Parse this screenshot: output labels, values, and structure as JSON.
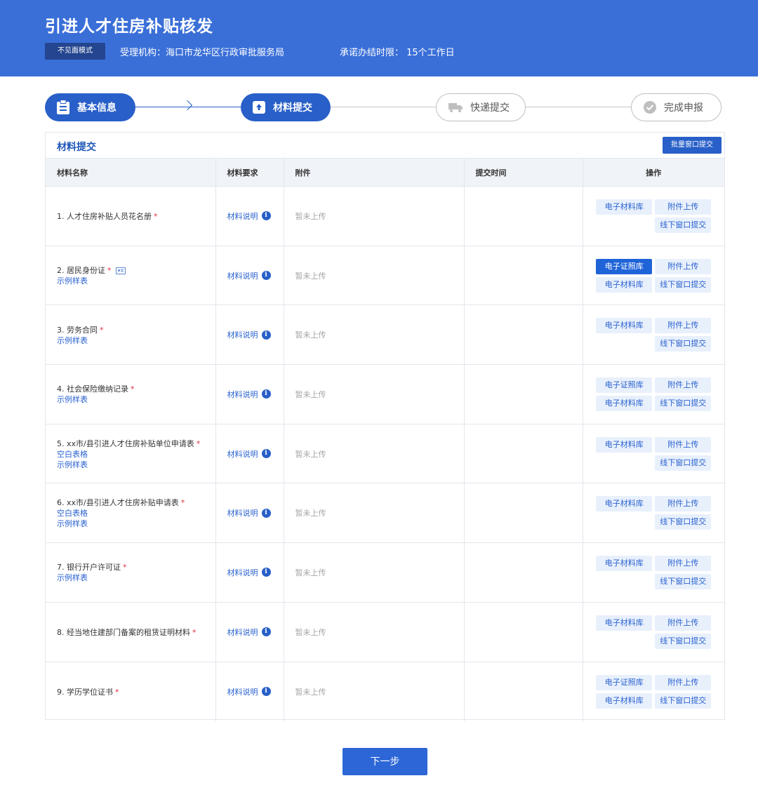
{
  "header": {
    "title": "引进人才住房补贴核发",
    "mode_badge": "不见面模式",
    "org": "受理机构：海口市龙华区行政审批服务局",
    "time_limit": "承诺办结时限： 15个工作日",
    "bg_color": "#3a6fd8"
  },
  "steps": [
    {
      "label": "基本信息",
      "state": "done",
      "icon": "clipboard-icon"
    },
    {
      "label": "材料提交",
      "state": "current",
      "icon": "upload-icon"
    },
    {
      "label": "快递提交",
      "state": "pending",
      "icon": "truck-icon"
    },
    {
      "label": "完成申报",
      "state": "pending",
      "icon": "check-circle-icon"
    }
  ],
  "panel": {
    "title": "材料提交",
    "batch_button": "批量窗口提交",
    "columns": [
      "材料名称",
      "材料要求",
      "附件",
      "提交时间",
      "操作"
    ]
  },
  "rows": [
    {
      "name": "1. 人才住房补贴人员花名册",
      "required": "*",
      "links": [],
      "req_label": "材料说明",
      "attachment": "暂未上传",
      "submit_time": "",
      "ops": [
        "电子材料库",
        "附件上传",
        "",
        "线下窗口提交"
      ]
    },
    {
      "name": "2. 居民身份证",
      "required": "*",
      "id_icon": true,
      "links": [
        "示例样表"
      ],
      "req_label": "材料说明",
      "attachment": "暂未上传",
      "submit_time": "",
      "ops": [
        "电子证照库",
        "附件上传",
        "电子材料库",
        "线下窗口提交"
      ],
      "primary": 0
    },
    {
      "name": "3. 劳务合同",
      "required": "*",
      "links": [
        "示例样表"
      ],
      "req_label": "材料说明",
      "attachment": "暂未上传",
      "submit_time": "",
      "ops": [
        "电子材料库",
        "附件上传",
        "",
        "线下窗口提交"
      ]
    },
    {
      "name": "4. 社会保险缴纳记录",
      "required": "*",
      "links": [
        "示例样表"
      ],
      "req_label": "材料说明",
      "attachment": "暂未上传",
      "submit_time": "",
      "ops": [
        "电子证照库",
        "附件上传",
        "电子材料库",
        "线下窗口提交"
      ]
    },
    {
      "name": "5. xx市/县引进人才住房补贴单位申请表",
      "required": "*",
      "links": [
        "空白表格",
        "示例样表"
      ],
      "req_label": "材料说明",
      "attachment": "暂未上传",
      "submit_time": "",
      "ops": [
        "电子材料库",
        "附件上传",
        "",
        "线下窗口提交"
      ]
    },
    {
      "name": "6. xx市/县引进人才住房补贴申请表",
      "required": "*",
      "links": [
        "空白表格",
        "示例样表"
      ],
      "req_label": "材料说明",
      "attachment": "暂未上传",
      "submit_time": "",
      "ops": [
        "电子材料库",
        "附件上传",
        "",
        "线下窗口提交"
      ]
    },
    {
      "name": "7. 银行开户许可证",
      "required": "*",
      "links": [
        "示例样表"
      ],
      "req_label": "材料说明",
      "attachment": "暂未上传",
      "submit_time": "",
      "ops": [
        "电子材料库",
        "附件上传",
        "",
        "线下窗口提交"
      ]
    },
    {
      "name": "8. 经当地住建部门备案的租赁证明材料",
      "required": "*",
      "links": [],
      "req_label": "材料说明",
      "attachment": "暂未上传",
      "submit_time": "",
      "ops": [
        "电子材料库",
        "附件上传",
        "",
        "线下窗口提交"
      ]
    },
    {
      "name": "9. 学历学位证书",
      "required": "*",
      "links": [],
      "req_label": "材料说明",
      "attachment": "暂未上传",
      "submit_time": "",
      "ops": [
        "电子证照库",
        "附件上传",
        "电子材料库",
        "线下窗口提交"
      ]
    }
  ],
  "next_button": "下一步"
}
